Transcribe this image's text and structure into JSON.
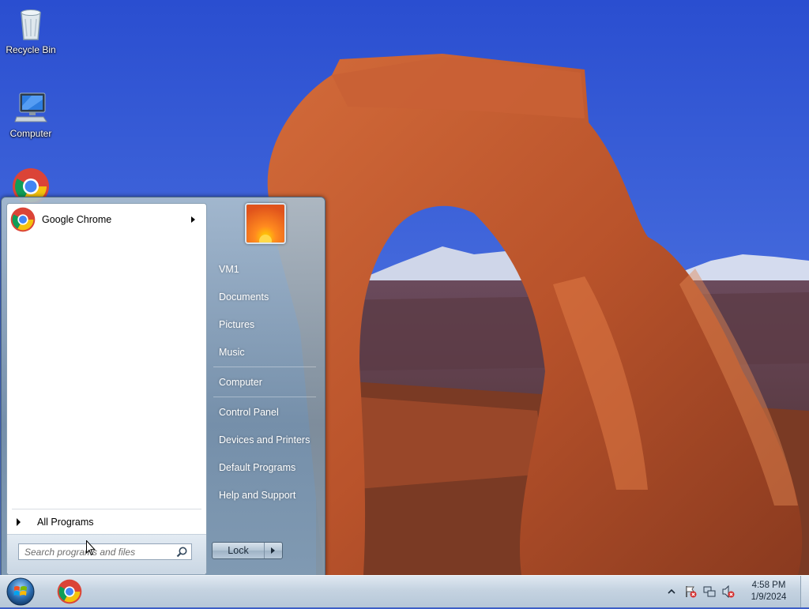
{
  "desktop": {
    "icons": [
      {
        "label": "Recycle Bin",
        "icon": "recycle-bin-icon"
      },
      {
        "label": "Computer",
        "icon": "computer-icon"
      },
      {
        "label": "",
        "icon": "chrome-icon"
      }
    ]
  },
  "start_menu": {
    "pinned_programs": [
      {
        "label": "Google Chrome",
        "icon": "chrome-icon",
        "has_submenu": true
      }
    ],
    "all_programs_label": "All Programs",
    "search": {
      "placeholder": "Search programs and files",
      "value": ""
    },
    "right_items_group1": [
      {
        "label": "VM1"
      },
      {
        "label": "Documents"
      },
      {
        "label": "Pictures"
      },
      {
        "label": "Music"
      }
    ],
    "right_items_group2": [
      {
        "label": "Computer"
      }
    ],
    "right_items_group3": [
      {
        "label": "Control Panel"
      },
      {
        "label": "Devices and Printers"
      },
      {
        "label": "Default Programs"
      },
      {
        "label": "Help and Support"
      }
    ],
    "lock_label": "Lock"
  },
  "taskbar": {
    "pinned": [
      {
        "icon": "chrome-icon"
      }
    ],
    "tray_icons": [
      "show-hidden-icons-chevron",
      "action-center-flag-icon",
      "network-icon",
      "volume-muted-icon"
    ],
    "clock": {
      "time": "4:58 PM",
      "date": "1/9/2024"
    }
  },
  "colors": {
    "sky": "#2f56cf",
    "rock": "#b8542c",
    "menu_glass": "#8fa6bb",
    "taskbar": "#c5d3e1"
  }
}
